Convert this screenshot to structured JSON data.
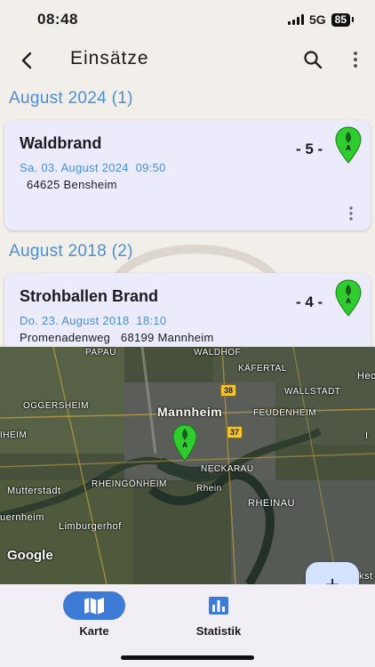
{
  "status": {
    "time": "08:48",
    "network": "5G",
    "battery": "85"
  },
  "appbar": {
    "title": "Einsätze",
    "back_icon": "back-arrow-icon",
    "search_icon": "search-icon",
    "more_icon": "more-vert-icon"
  },
  "sections": [
    {
      "header": "August 2024 (1)",
      "cards": [
        {
          "title": "Waldbrand",
          "date": "Sa. 03. August 2024  09:50",
          "address": "64625 Bensheim",
          "number": "- 5 -",
          "pin_letter": "A"
        }
      ]
    },
    {
      "header": "August 2018 (2)",
      "cards": [
        {
          "title": "Strohballen Brand",
          "date": "Do. 23. August 2018  18:10",
          "address": "Promenadenweg   68199 Mannheim",
          "number": "- 4 -",
          "pin_letter": "A"
        }
      ]
    }
  ],
  "map": {
    "labels": {
      "papau": "PAPAU",
      "waldhof": "WALDHOF",
      "kafertal": "KÄFERTAL",
      "hec": "Hec",
      "oggersheim": "OGGERSHEIM",
      "wallstadt": "WALLSTADT",
      "mannheim": "Mannheim",
      "feudenheim": "FEUDENHEIM",
      "ihein": "IHEIM",
      "neckarau": "NECKARAU",
      "mutterstadt": "Mutterstadt",
      "rheingoenheim": "RHEINGÖNHEIM",
      "rhein": "Rhein",
      "rheinau": "RHEINAU",
      "uernheim": "uernheim",
      "limburgerhof": "Limburgerhof",
      "kst": "kst",
      "ri": "I"
    },
    "shields": {
      "s37": "37",
      "s38": "38"
    },
    "attribution": "Google",
    "pin_letter": "A"
  },
  "fab": {
    "label": "+"
  },
  "nav": {
    "items": [
      {
        "label": "Karte",
        "icon": "map-icon",
        "active": true
      },
      {
        "label": "Statistik",
        "icon": "bar-chart-icon",
        "active": false
      }
    ]
  },
  "colors": {
    "accent": "#4a8fd9",
    "card_bg": "#ebebfb",
    "pin_green": "#2ecc2e",
    "nav_active": "#3d7bd6"
  }
}
